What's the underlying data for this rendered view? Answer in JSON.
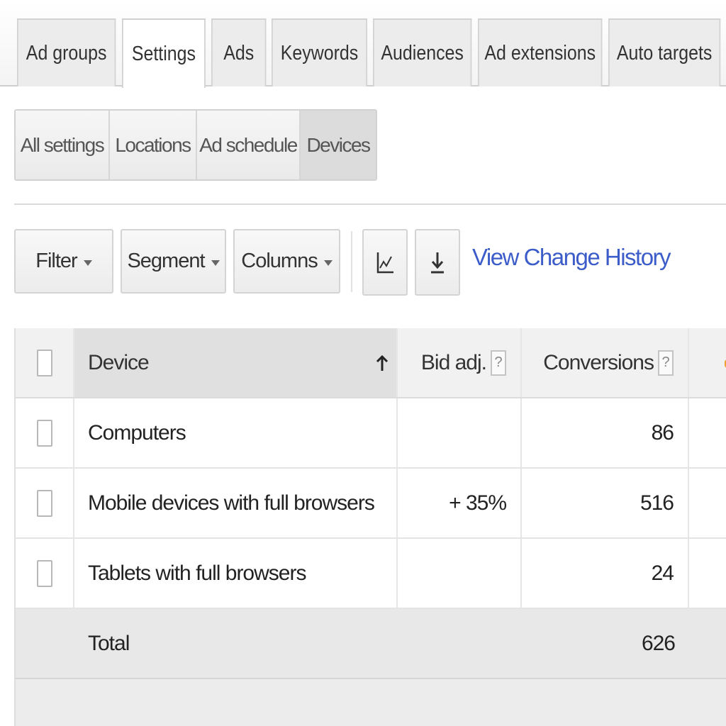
{
  "top_tabs": [
    {
      "label": "Ad groups"
    },
    {
      "label": "Settings"
    },
    {
      "label": "Ads"
    },
    {
      "label": "Keywords"
    },
    {
      "label": "Audiences"
    },
    {
      "label": "Ad extensions"
    },
    {
      "label": "Auto targets"
    }
  ],
  "active_top_tab": "Settings",
  "sub_tabs": [
    {
      "label": "All settings"
    },
    {
      "label": "Locations"
    },
    {
      "label": "Ad schedule"
    },
    {
      "label": "Devices"
    }
  ],
  "active_sub_tab": "Devices",
  "toolbar": {
    "filter_label": "Filter",
    "segment_label": "Segment",
    "columns_label": "Columns",
    "chart_icon": "line-chart-icon",
    "download_icon": "download-icon",
    "history_link": "View Change History"
  },
  "table": {
    "headers": {
      "device": "Device",
      "bid_adj": "Bid adj.",
      "conversions": "Conversions",
      "help": "?"
    },
    "sort": {
      "column": "Device",
      "direction": "ascending"
    },
    "rows": [
      {
        "device": "Computers",
        "bid_adj": "",
        "conversions": "86"
      },
      {
        "device": "Mobile devices with full browsers",
        "bid_adj": "+ 35%",
        "conversions": "516"
      },
      {
        "device": "Tablets with full browsers",
        "bid_adj": "",
        "conversions": "24"
      }
    ],
    "total": {
      "label": "Total",
      "conversions": "626"
    }
  },
  "colors": {
    "link": "#3b5cc9",
    "active_subtab": "#dcdcdc",
    "total_row": "#e8e8e8"
  }
}
